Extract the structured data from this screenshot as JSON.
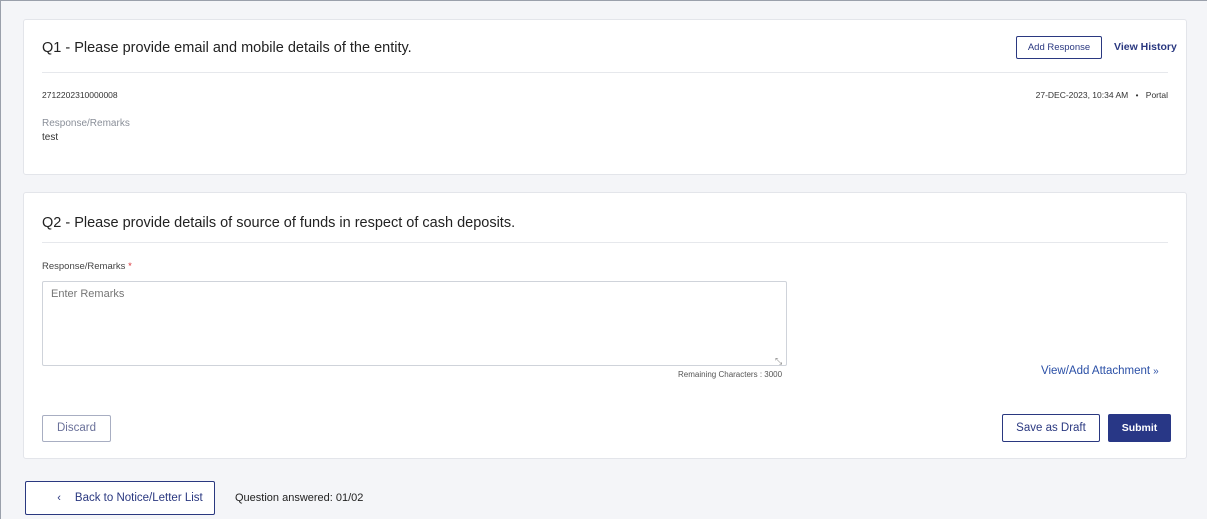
{
  "q1": {
    "title": "Q1 - Please provide email and mobile details of the entity.",
    "add_response_label": "Add Response",
    "view_history_label": "View History",
    "reference_id": "2712202310000008",
    "timestamp": "27-DEC-2023, 10:34 AM",
    "separator": "•",
    "source": "Portal",
    "response_label": "Response/Remarks",
    "response_value": "test"
  },
  "q2": {
    "title": "Q2 - Please provide details of source of funds in respect of cash deposits.",
    "response_label": "Response/Remarks",
    "required_marker": "*",
    "remarks_placeholder": "Enter Remarks",
    "remarks_value": "",
    "remaining_characters": "Remaining Characters : 3000",
    "attachment_link": "View/Add Attachment",
    "discard_label": "Discard",
    "save_draft_label": "Save as Draft",
    "submit_label": "Submit"
  },
  "footer": {
    "back_label": "Back to Notice/Letter List",
    "progress_text": "Question answered: 01/02"
  },
  "icons": {
    "chevron_left": "chevron-left-icon",
    "double_chevron_down": "double-chevron-down-icon",
    "resize_grip": "resize-grip-icon"
  },
  "colors": {
    "primary": "#283786",
    "link": "#2a4fa6",
    "required": "#d9343a",
    "background": "#f4f5f8"
  }
}
